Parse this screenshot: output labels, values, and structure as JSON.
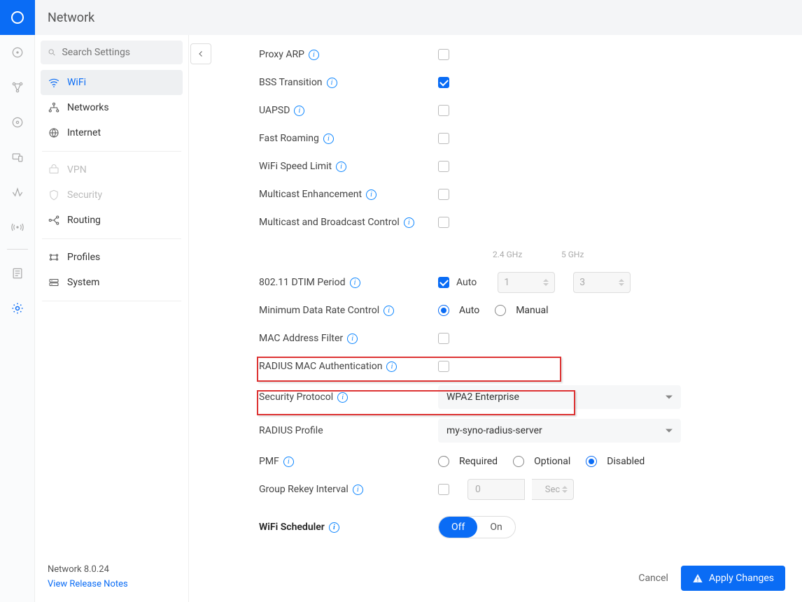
{
  "header": {
    "title": "Network"
  },
  "search": {
    "placeholder": "Search Settings"
  },
  "sidebar": {
    "items": [
      {
        "label": "WiFi"
      },
      {
        "label": "Networks"
      },
      {
        "label": "Internet"
      },
      {
        "label": "VPN"
      },
      {
        "label": "Security"
      },
      {
        "label": "Routing"
      },
      {
        "label": "Profiles"
      },
      {
        "label": "System"
      }
    ],
    "version": "Network 8.0.24",
    "release_link": "View Release Notes"
  },
  "settings": {
    "proxy_arp": "Proxy ARP",
    "bss_transition": "BSS Transition",
    "uapsd": "UAPSD",
    "fast_roaming": "Fast Roaming",
    "wifi_speed_limit": "WiFi Speed Limit",
    "multicast_enhancement": "Multicast Enhancement",
    "multicast_broadcast": "Multicast and Broadcast Control",
    "dtim_label": "802.11 DTIM Period",
    "dtim_auto": "Auto",
    "dtim_24_header": "2.4 GHz",
    "dtim_5_header": "5 GHz",
    "dtim_24_val": "1",
    "dtim_5_val": "3",
    "min_data_rate": "Minimum Data Rate Control",
    "mdr_auto": "Auto",
    "mdr_manual": "Manual",
    "mac_filter": "MAC Address Filter",
    "radius_mac_auth": "RADIUS MAC Authentication",
    "security_protocol_label": "Security Protocol",
    "security_protocol_value": "WPA2 Enterprise",
    "radius_profile_label": "RADIUS Profile",
    "radius_profile_value": "my-syno-radius-server",
    "pmf_label": "PMF",
    "pmf_required": "Required",
    "pmf_optional": "Optional",
    "pmf_disabled": "Disabled",
    "group_rekey": "Group Rekey Interval",
    "group_rekey_val": "0",
    "group_rekey_unit": "Sec",
    "wifi_scheduler": "WiFi Scheduler",
    "scheduler_off": "Off",
    "scheduler_on": "On"
  },
  "footer": {
    "cancel": "Cancel",
    "apply": "Apply Changes"
  }
}
